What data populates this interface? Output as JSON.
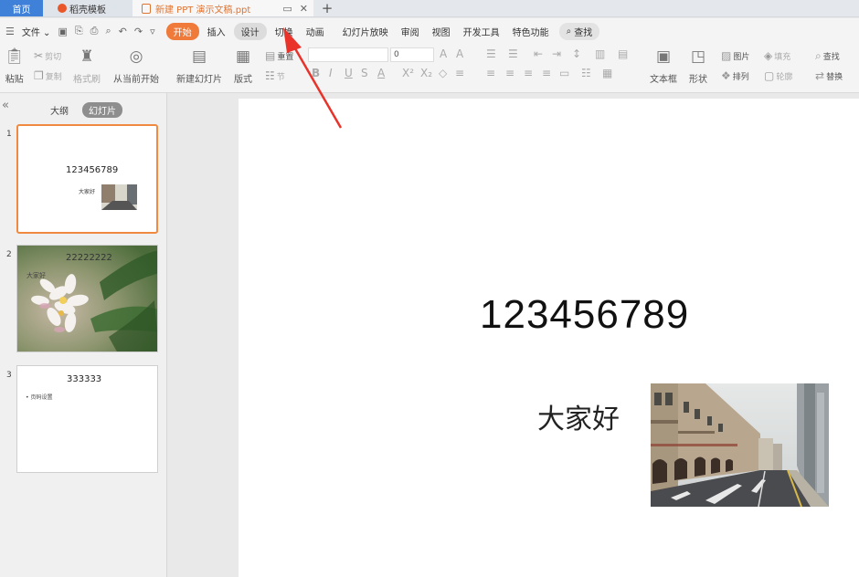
{
  "tabs": {
    "home": "首页",
    "docer": "稻壳模板",
    "document": "新建 PPT 演示文稿.ppt",
    "new_tab": "+"
  },
  "menu": {
    "file": "文件",
    "items": [
      "开始",
      "插入",
      "设计",
      "切换",
      "动画",
      "幻灯片放映",
      "审阅",
      "视图",
      "开发工具",
      "特色功能"
    ],
    "active": "开始",
    "search": "查找"
  },
  "ribbon": {
    "paste": "粘贴",
    "cut": "剪切",
    "copy": "复制",
    "format_painter": "格式刷",
    "play_from_current": "从当前开始",
    "new_slide": "新建幻灯片",
    "layout": "版式",
    "reset": "重置",
    "section": "节",
    "font_size": "0",
    "textbox": "文本框",
    "shape": "形状",
    "picture": "图片",
    "fill": "填充",
    "arrange": "排列",
    "outline": "轮廓",
    "find": "查找",
    "replace": "替换"
  },
  "panel": {
    "outline_tab": "大纲",
    "slides_tab": "幻灯片"
  },
  "slides": [
    {
      "number": "1",
      "title": "123456789",
      "subtitle": "大家好"
    },
    {
      "number": "2",
      "title": "22222222",
      "subtitle": "大家好"
    },
    {
      "number": "3",
      "title": "333333",
      "bullet": "• 页码设置"
    }
  ],
  "main_slide": {
    "title": "123456789",
    "subtitle": "大家好"
  },
  "colors": {
    "accent": "#f07a3a",
    "home_tab": "#3f80d8",
    "arrow": "#e8322a"
  }
}
